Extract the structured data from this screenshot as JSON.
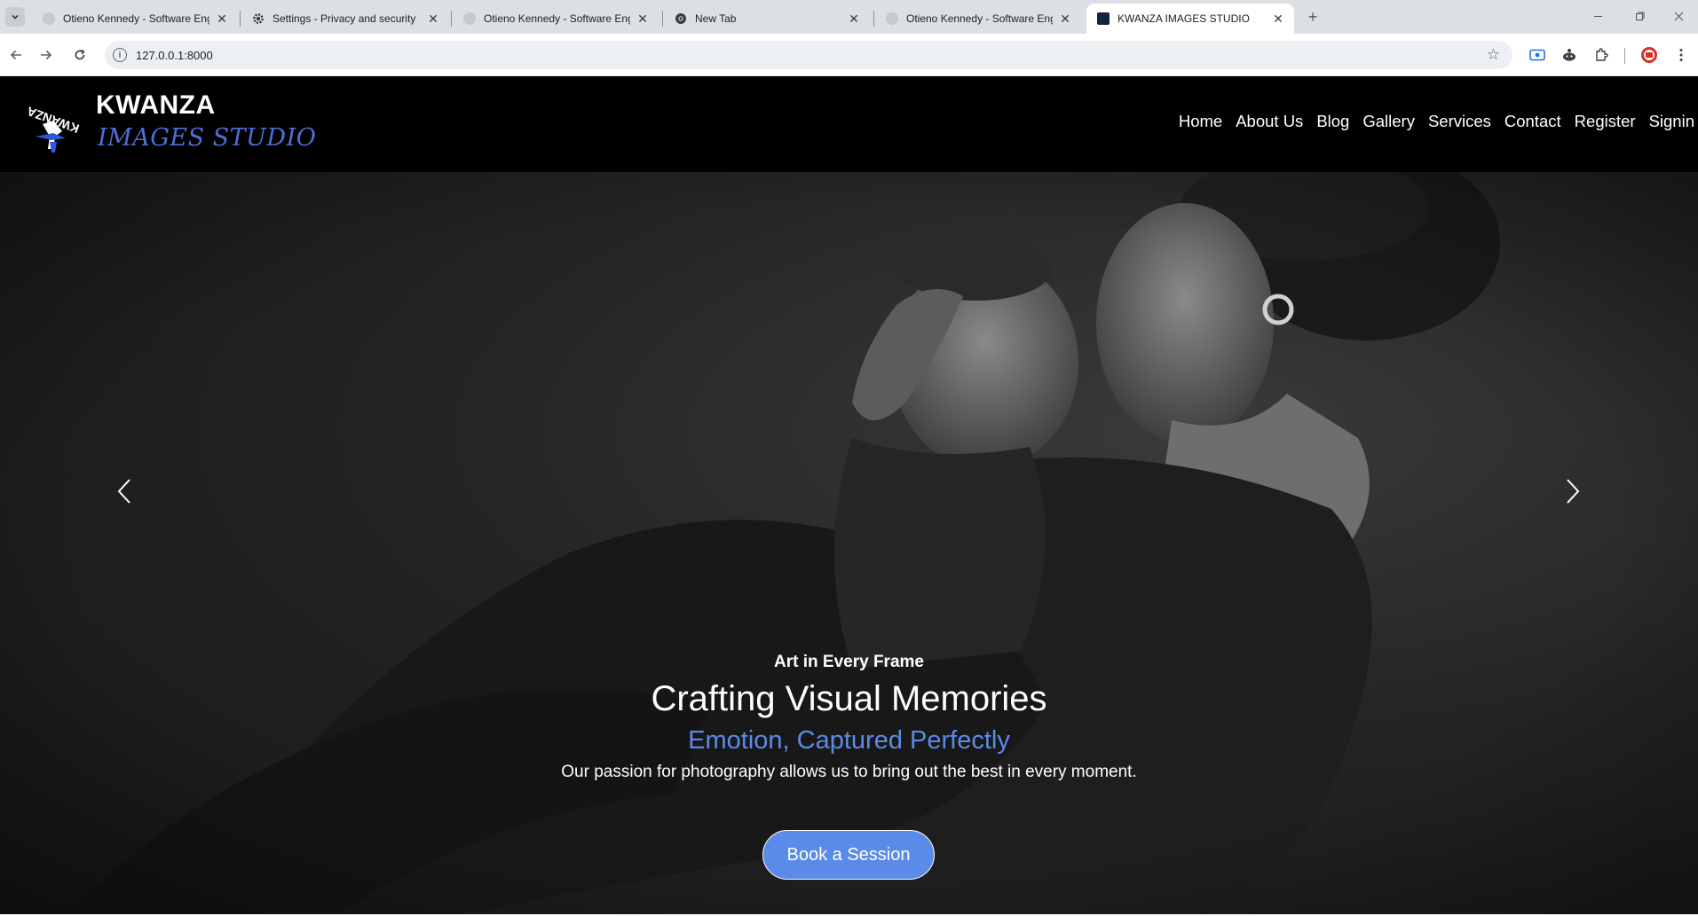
{
  "browser": {
    "tabs": [
      {
        "title": "Otieno Kennedy - Software Eng",
        "active": false
      },
      {
        "title": "Settings - Privacy and security",
        "active": false
      },
      {
        "title": "Otieno Kennedy - Software Eng",
        "active": false
      },
      {
        "title": "New Tab",
        "active": false
      },
      {
        "title": "Otieno Kennedy - Software Eng",
        "active": false
      },
      {
        "title": "KWANZA IMAGES STUDIO",
        "active": true
      }
    ],
    "url": "127.0.0.1:8000"
  },
  "site": {
    "brand": {
      "name": "KWANZA",
      "tagline": "IMAGES STUDIO",
      "logo_text": "KWANZA IMAGES"
    },
    "nav": [
      "Home",
      "About Us",
      "Blog",
      "Gallery",
      "Services",
      "Contact",
      "Register",
      "Signin"
    ],
    "hero": {
      "kicker": "Art in Every Frame",
      "title": "Crafting Visual Memories",
      "subtitle": "Emotion, Captured Perfectly",
      "text": "Our passion for photography allows us to bring out the best in every moment.",
      "cta": "Book a Session"
    }
  },
  "colors": {
    "accent": "#5b8be8",
    "brand_blue": "#4f6fd6",
    "header_bg": "#000000"
  }
}
